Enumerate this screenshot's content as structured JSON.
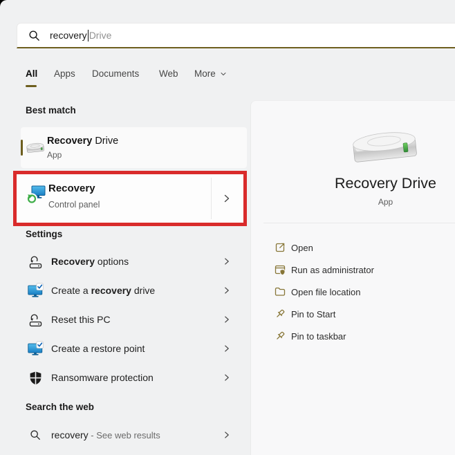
{
  "search": {
    "query": "recovery",
    "suggestion": "Drive"
  },
  "tabs": {
    "all": "All",
    "apps": "Apps",
    "documents": "Documents",
    "web": "Web",
    "more": "More"
  },
  "sections": {
    "best_match": {
      "header": "Best match",
      "item": {
        "title_bold": "Recovery",
        "title_rest": " Drive",
        "subtitle": "App",
        "icon": "hard-drive-icon"
      }
    },
    "highlighted": {
      "title": "Recovery",
      "subtitle": "Control panel",
      "icon": "control-panel-recovery-icon"
    },
    "settings": {
      "header": "Settings",
      "items": [
        {
          "pre": "",
          "bold": "Recovery",
          "post": " options",
          "icon": "reset-pc-icon"
        },
        {
          "pre": "Create a ",
          "bold": "recovery",
          "post": " drive",
          "icon": "monitor-check-icon"
        },
        {
          "pre": "Reset this PC",
          "bold": "",
          "post": "",
          "icon": "reset-pc-icon"
        },
        {
          "pre": "Create a restore point",
          "bold": "",
          "post": "",
          "icon": "monitor-check-icon"
        },
        {
          "pre": "Ransomware protection",
          "bold": "",
          "post": "",
          "icon": "security-shield-icon"
        }
      ]
    },
    "web": {
      "header": "Search the web",
      "item": {
        "query": "recovery",
        "rest": " - See web results",
        "icon": "search-icon"
      }
    }
  },
  "preview": {
    "title": "Recovery Drive",
    "subtitle": "App",
    "icon": "hard-drive-large-icon",
    "actions": [
      {
        "label": "Open",
        "icon": "open-icon"
      },
      {
        "label": "Run as administrator",
        "icon": "admin-window-icon"
      },
      {
        "label": "Open file location",
        "icon": "folder-icon"
      },
      {
        "label": "Pin to Start",
        "icon": "pin-icon"
      },
      {
        "label": "Pin to taskbar",
        "icon": "pin-icon"
      }
    ]
  },
  "colors": {
    "accent_gold": "#6d5e1e",
    "action_icon_gold": "#877637",
    "highlight_red": "#d92b2b",
    "background": "#f0f1f2",
    "preview_background": "#f8f8f9"
  }
}
